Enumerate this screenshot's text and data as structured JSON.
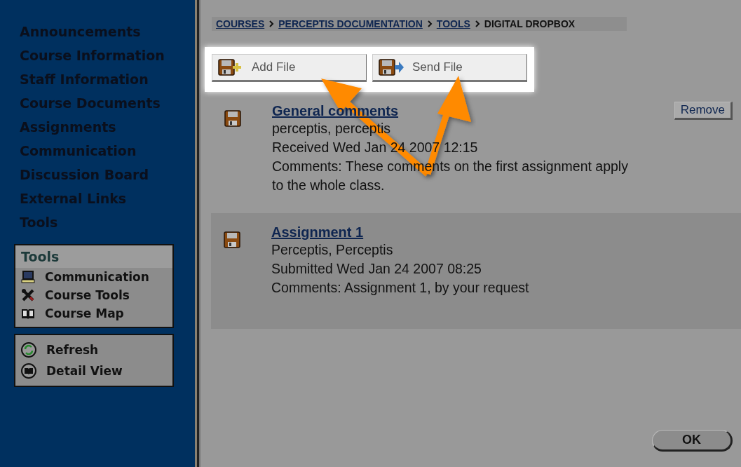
{
  "sidebar": {
    "nav": [
      {
        "label": "Announcements"
      },
      {
        "label": "Course Information"
      },
      {
        "label": "Staff Information"
      },
      {
        "label": "Course Documents"
      },
      {
        "label": "Assignments"
      },
      {
        "label": "Communication"
      },
      {
        "label": "Discussion Board"
      },
      {
        "label": "External Links"
      },
      {
        "label": "Tools"
      }
    ],
    "tools_box": {
      "title": "Tools",
      "items": [
        {
          "label": "Communication",
          "kind": "laptop"
        },
        {
          "label": "Course Tools",
          "kind": "tools"
        },
        {
          "label": "Course Map",
          "kind": "map"
        }
      ]
    },
    "actions": [
      {
        "label": "Refresh",
        "kind": "refresh"
      },
      {
        "label": "Detail View",
        "kind": "detail"
      }
    ]
  },
  "breadcrumb": [
    {
      "label": "COURSES",
      "link": true
    },
    {
      "label": "PERCEPTIS DOCUMENTATION",
      "link": true
    },
    {
      "label": "TOOLS",
      "link": true
    },
    {
      "label": "DIGITAL DROPBOX",
      "link": false
    }
  ],
  "toolbar": [
    {
      "label": "Add File",
      "kind": "add"
    },
    {
      "label": "Send File",
      "kind": "send"
    }
  ],
  "files": [
    {
      "title": "General comments",
      "lines": [
        "perceptis, perceptis",
        "Received Wed Jan 24 2007 12:15",
        "Comments: These comments on the first assignment apply to the whole class."
      ],
      "shaded": false,
      "action": "Remove"
    },
    {
      "title": "Assignment 1",
      "lines": [
        "Perceptis, Perceptis",
        "Submitted Wed Jan 24 2007 08:25",
        "Comments: Assignment 1, by your request"
      ],
      "shaded": true
    }
  ],
  "ok_button": "OK"
}
